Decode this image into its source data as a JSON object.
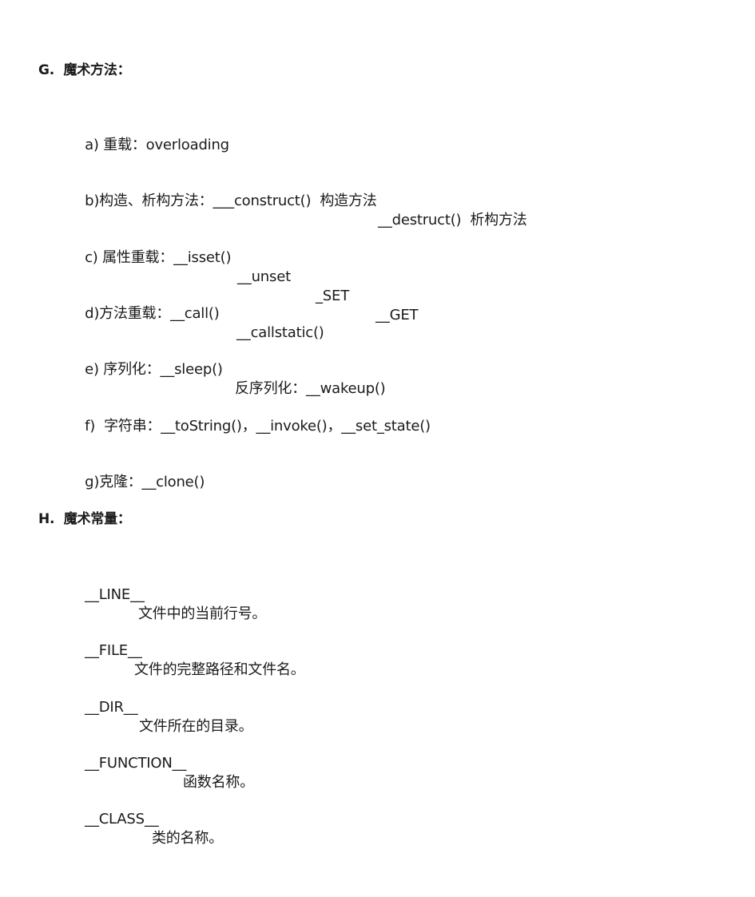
{
  "document": {
    "sections": [
      {
        "heading": "G.  魔术方法：",
        "items": [
          [
            "a) 重载：overloading"
          ],
          [
            "b)构造、析构方法：___construct()  构造方法",
            "__destruct()  析构方法"
          ],
          [
            "c) 属性重载：__isset()",
            "__unset",
            "_SET",
            "__GET"
          ],
          [
            "d)方法重载：__call()",
            "__callstatic()"
          ],
          [
            "e) 序列化：__sleep()",
            "反序列化：__wakeup()"
          ],
          [
            "f)  字符串：__toString()，__invoke()，__set_state()"
          ],
          [
            "g)克隆：__clone()"
          ]
        ]
      },
      {
        "heading": "H.  魔术常量：",
        "items": [
          [
            "__LINE__",
            "文件中的当前行号。"
          ],
          [
            "__FILE__",
            "文件的完整路径和文件名。"
          ],
          [
            "__DIR__",
            "文件所在的目录。"
          ],
          [
            "__FUNCTION__",
            "函数名称。"
          ],
          [
            "__CLASS__",
            "类的名称。"
          ]
        ]
      }
    ]
  }
}
